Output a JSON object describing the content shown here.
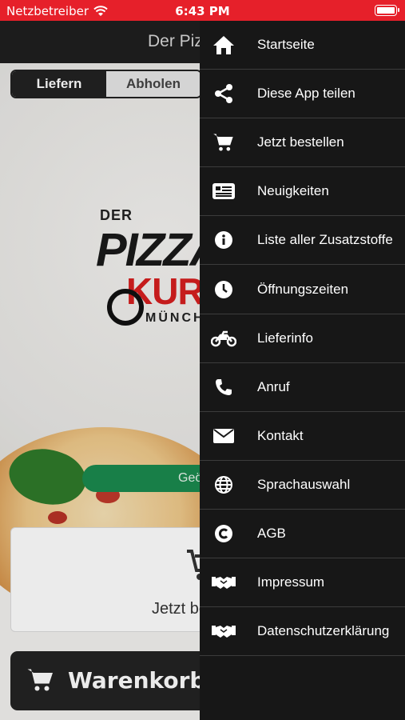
{
  "status_bar": {
    "carrier": "Netzbetreiber",
    "time": "6:43 PM"
  },
  "header": {
    "title": "Der Pizza Kurier"
  },
  "order_mode": {
    "tabs": [
      {
        "label": "Liefern",
        "selected": true
      },
      {
        "label": "Abholen",
        "selected": false
      }
    ]
  },
  "logo": {
    "line1": "DER",
    "line2": "PIZZA",
    "line3": "KURIER",
    "line4": "MÜNCHEN"
  },
  "hero": {
    "status_button": "Geöffnet"
  },
  "order_card": {
    "text": "Jetzt bestellen"
  },
  "cart_bar": {
    "label": "Warenkorb"
  },
  "menu": {
    "items": [
      {
        "label": "Startseite",
        "icon": "home-icon"
      },
      {
        "label": "Diese App teilen",
        "icon": "share-icon"
      },
      {
        "label": "Jetzt bestellen",
        "icon": "cart-icon"
      },
      {
        "label": "Neuigkeiten",
        "icon": "news-icon"
      },
      {
        "label": "Liste aller Zusatzstoffe",
        "icon": "info-icon"
      },
      {
        "label": "Öffnungszeiten",
        "icon": "clock-icon"
      },
      {
        "label": "Lieferinfo",
        "icon": "motorcycle-icon"
      },
      {
        "label": "Anruf",
        "icon": "phone-icon"
      },
      {
        "label": "Kontakt",
        "icon": "mail-icon"
      },
      {
        "label": "Sprachauswahl",
        "icon": "globe-icon"
      },
      {
        "label": "AGB",
        "icon": "copyright-icon"
      },
      {
        "label": "Impressum",
        "icon": "handshake-icon"
      },
      {
        "label": "Datenschutzerklärung",
        "icon": "handshake-icon"
      }
    ]
  },
  "colors": {
    "status_bar": "#e6202a",
    "drawer_bg": "#171717",
    "open_button": "#1b8a4f",
    "logo_red": "#d61f1f"
  }
}
